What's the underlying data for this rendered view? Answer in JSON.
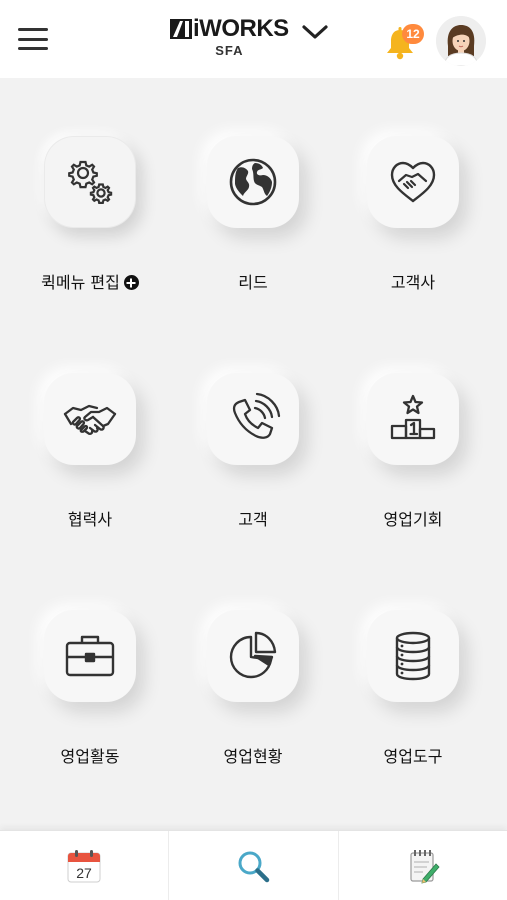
{
  "header": {
    "logo_main": "iWORKS",
    "logo_sub": "SFA",
    "notification_count": "12",
    "icons": [
      "hamburger-icon",
      "chevron-down-icon",
      "bell-icon",
      "avatar"
    ]
  },
  "menu": [
    {
      "label": "퀵메뉴 편집",
      "icon": "gears-icon"
    },
    {
      "label": "리드",
      "icon": "globe-icon"
    },
    {
      "label": "고객사",
      "icon": "heart-handshake-icon"
    },
    {
      "label": "협력사",
      "icon": "handshake-icon"
    },
    {
      "label": "고객",
      "icon": "phone-icon"
    },
    {
      "label": "영업기회",
      "icon": "podium-icon"
    },
    {
      "label": "영업활동",
      "icon": "briefcase-icon"
    },
    {
      "label": "영업현황",
      "icon": "pie-chart-icon"
    },
    {
      "label": "영업도구",
      "icon": "database-icon"
    }
  ],
  "bottom_nav": {
    "calendar_day": "27",
    "items": [
      "calendar-icon",
      "search-icon",
      "memo-icon"
    ]
  },
  "colors": {
    "badge": "#ff8a3d",
    "bell": "#f5b41e",
    "search": "#4aa8c8",
    "calendar_top": "#e8543f"
  }
}
